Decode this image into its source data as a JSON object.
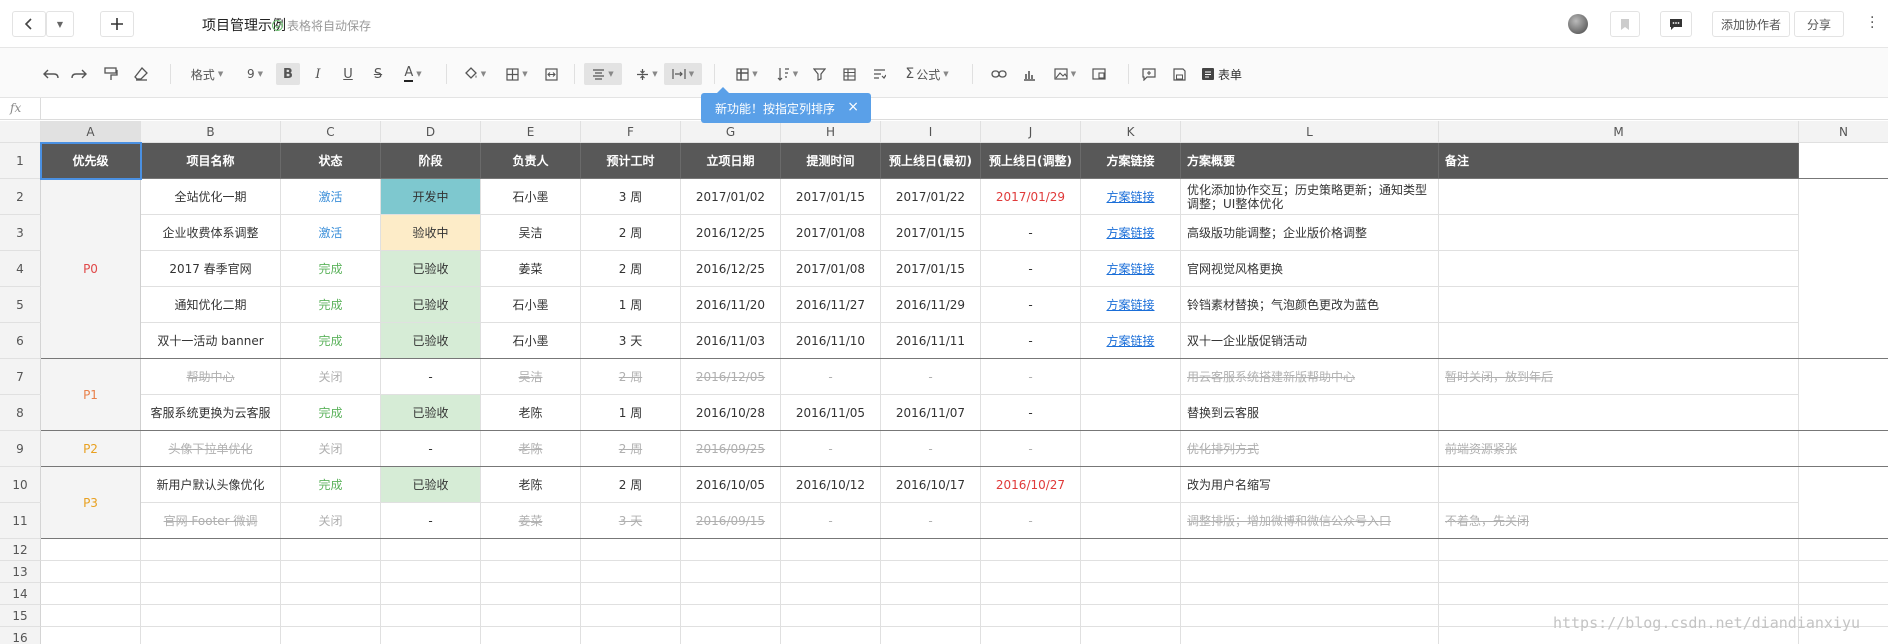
{
  "topbar": {
    "title": "项目管理示例",
    "save_status": "表格将自动保存",
    "add_collaborator": "添加协作者",
    "share": "分享"
  },
  "toolbar": {
    "format_label": "格式",
    "font_size": "9",
    "bold": "B",
    "italic": "I",
    "underline": "U",
    "strike": "S",
    "text_color": "A",
    "sum_label": "公式",
    "form_label": "表单"
  },
  "formula_bar": {
    "fx": "fx"
  },
  "tooltip": {
    "text": "新功能！按指定列排序",
    "close": "×"
  },
  "columns": [
    "A",
    "B",
    "C",
    "D",
    "E",
    "F",
    "G",
    "H",
    "I",
    "J",
    "K",
    "L",
    "M",
    "N"
  ],
  "row_numbers": [
    "1",
    "2",
    "3",
    "4",
    "5",
    "6",
    "7",
    "8",
    "9",
    "10",
    "11",
    "12",
    "13",
    "14",
    "15",
    "16"
  ],
  "headers": [
    "优先级",
    "项目名称",
    "状态",
    "阶段",
    "负责人",
    "预计工时",
    "立项日期",
    "提测时间",
    "预上线日(最初)",
    "预上线日(调整)",
    "方案链接",
    "方案概要",
    "备注"
  ],
  "priorities": [
    "P0",
    "P1",
    "P2",
    "P3"
  ],
  "rows": [
    [
      "全站优化一期",
      "激活",
      "开发中",
      "石小墨",
      "3 周",
      "2017/01/02",
      "2017/01/15",
      "2017/01/22",
      "2017/01/29",
      "方案链接",
      "优化添加协作交互；历史策略更新；通知类型调整；UI整体优化",
      ""
    ],
    [
      "企业收费体系调整",
      "激活",
      "验收中",
      "吴洁",
      "2 周",
      "2016/12/25",
      "2017/01/08",
      "2017/01/15",
      "-",
      "方案链接",
      "高级版功能调整；企业版价格调整",
      ""
    ],
    [
      "2017 春季官网",
      "完成",
      "已验收",
      "姜菜",
      "2 周",
      "2016/12/25",
      "2017/01/08",
      "2017/01/15",
      "-",
      "方案链接",
      "官网视觉风格更换",
      ""
    ],
    [
      "通知优化二期",
      "完成",
      "已验收",
      "石小墨",
      "1 周",
      "2016/11/20",
      "2016/11/27",
      "2016/11/29",
      "-",
      "方案链接",
      "铃铛素材替换；气泡颜色更改为蓝色",
      ""
    ],
    [
      "双十一活动 banner",
      "完成",
      "已验收",
      "石小墨",
      "3 天",
      "2016/11/03",
      "2016/11/10",
      "2016/11/11",
      "-",
      "方案链接",
      "双十一企业版促销活动",
      ""
    ],
    [
      "帮助中心",
      "关闭",
      "-",
      "吴洁",
      "2 周",
      "2016/12/05",
      "-",
      "-",
      "-",
      "",
      "用云客服系统搭建新版帮助中心",
      "暂时关闭，放到年后"
    ],
    [
      "客服系统更换为云客服",
      "完成",
      "已验收",
      "老陈",
      "1 周",
      "2016/10/28",
      "2016/11/05",
      "2016/11/07",
      "-",
      "",
      "替换到云客服",
      ""
    ],
    [
      "头像下拉单优化",
      "关闭",
      "-",
      "老陈",
      "2 周",
      "2016/09/25",
      "-",
      "-",
      "-",
      "",
      "优化排列方式",
      "前端资源紧张"
    ],
    [
      "新用户默认头像优化",
      "完成",
      "已验收",
      "老陈",
      "2 周",
      "2016/10/05",
      "2016/10/12",
      "2016/10/17",
      "2016/10/27",
      "",
      "改为用户名缩写",
      ""
    ],
    [
      "官网 Footer 微调",
      "关闭",
      "-",
      "姜菜",
      "3 天",
      "2016/09/15",
      "-",
      "-",
      "-",
      "",
      "调整排版；增加微博和微信公众号入口",
      "不着急，先关闭"
    ]
  ],
  "watermark": "https://blog.csdn.net/diandianxiyu"
}
